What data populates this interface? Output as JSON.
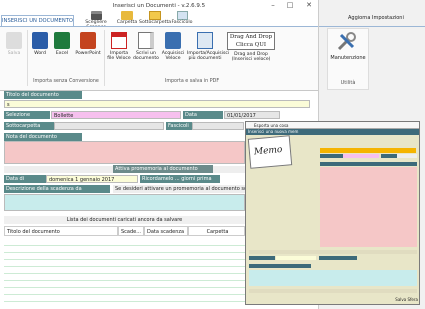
{
  "window": {
    "title": "Inserisci un Documenti - v.2.6.9.5"
  },
  "top_icons": [
    {
      "label": "Scegliere Scanner",
      "name": "printer-icon"
    },
    {
      "label": "Carpetta",
      "name": "folder-icon"
    },
    {
      "label": "Sottocarpetta",
      "name": "subfolder-icon"
    },
    {
      "label": "Fascicolo",
      "name": "file-bundle-icon"
    }
  ],
  "right_links": {
    "aggiorna": "Aggiorna",
    "impostazioni": "Impostazioni",
    "manutenzione": "Manutenzione",
    "utilita": "Utilità"
  },
  "tabs": {
    "active": "INSERISCI UN DOCUMENTO"
  },
  "ribbon": {
    "buttons": [
      {
        "label": "Salva",
        "name": "save-button"
      },
      {
        "label": "Word",
        "name": "word-button"
      },
      {
        "label": "Excel",
        "name": "excel-button"
      },
      {
        "label": "PowerPoint",
        "name": "powerpoint-button"
      },
      {
        "label": "Importa file Veloce",
        "name": "import-fast-button"
      },
      {
        "label": "Scrivi un documento",
        "name": "write-document-button"
      },
      {
        "label": "Acquisisci Veloce",
        "name": "acquire-fast-button"
      },
      {
        "label": "Importa/Acquisisci più documenti",
        "name": "import-multi-button"
      },
      {
        "label": "Drag and Drop (Inserisci veloce)",
        "name": "drag-drop-button"
      }
    ],
    "dragdrop_text_1": "Drag And Drop",
    "dragdrop_text_2": "Clicca QUI",
    "group_1": "Importa senza Conversione",
    "group_2": "Importa e salva in PDF"
  },
  "form": {
    "titolo_label": "Titolo del documento",
    "titolo_value": "s",
    "carpetta_label": "Selezione Carpetta",
    "carpetta_value": "Bollette",
    "data_ins_label": "Data inserimento",
    "data_ins_value": "01/01/2017",
    "sottocarpetta_label": "Sottocarpetta",
    "fascicoli_label": "Fascicoli",
    "nota_label": "Nota del documento",
    "promemoria_label": "Attiva promemoria al documento",
    "scadenza_label": "Data di scadenza",
    "scadenza_value": "domenica 1 gennaio 2017",
    "ricordamelo_label": "Ricordamelo ... giorni prima",
    "descr_label": "Descrizione della scadenza da visualizzare",
    "promemoria_hint": "Se desideri attivare un promemoria al documento scrivi ..."
  },
  "table": {
    "header": "Lista dei documenti caricati ancora da salvare",
    "columns": [
      "Titolo del documento",
      "Scade...",
      "Data scadenza",
      "Carpetta"
    ]
  },
  "popup": {
    "title": "Esporta una cosa",
    "subtitle": "Inserisci una nuova mem",
    "memo_label": "Memo",
    "footer": "Salva Sfera"
  }
}
